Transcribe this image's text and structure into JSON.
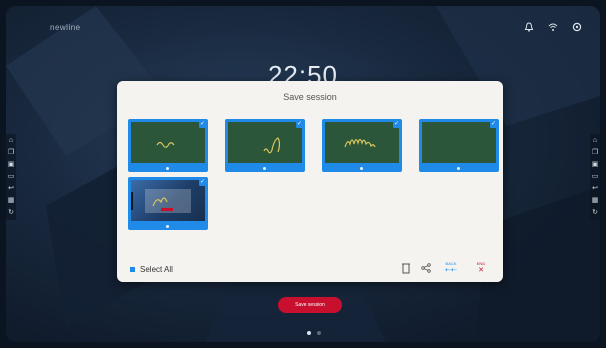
{
  "desktop": {
    "brand": "newline",
    "clock": "22:50",
    "status_icons": [
      "bell-icon",
      "wifi-icon",
      "settings-icon"
    ],
    "left_toolbar": [
      "home-icon",
      "copy-icon",
      "screen-icon",
      "monitor-icon",
      "back-icon",
      "apps-icon",
      "refresh-icon"
    ],
    "right_toolbar": [
      "home-icon",
      "copy-icon",
      "screen-icon",
      "monitor-icon",
      "back-icon",
      "apps-icon",
      "refresh-icon"
    ],
    "pager": {
      "pages": 2,
      "active": 0
    }
  },
  "dialog": {
    "title": "Save session",
    "thumbnails": [
      {
        "type": "whiteboard",
        "selected": true
      },
      {
        "type": "whiteboard",
        "selected": true
      },
      {
        "type": "whiteboard",
        "selected": true
      },
      {
        "type": "whiteboard",
        "selected": true
      },
      {
        "type": "screenshot",
        "selected": true
      }
    ],
    "select_all_label": "Select All",
    "actions": {
      "delete_icon": "trash-icon",
      "share_icon": "share-icon",
      "back_label": "BACK",
      "end_label": "END"
    }
  },
  "save_button_label": "Save session",
  "colors": {
    "accent": "#1f8ae8",
    "whiteboard": "#2c563a",
    "danger": "#c8102e",
    "dialog_bg": "#f4f3ef"
  }
}
